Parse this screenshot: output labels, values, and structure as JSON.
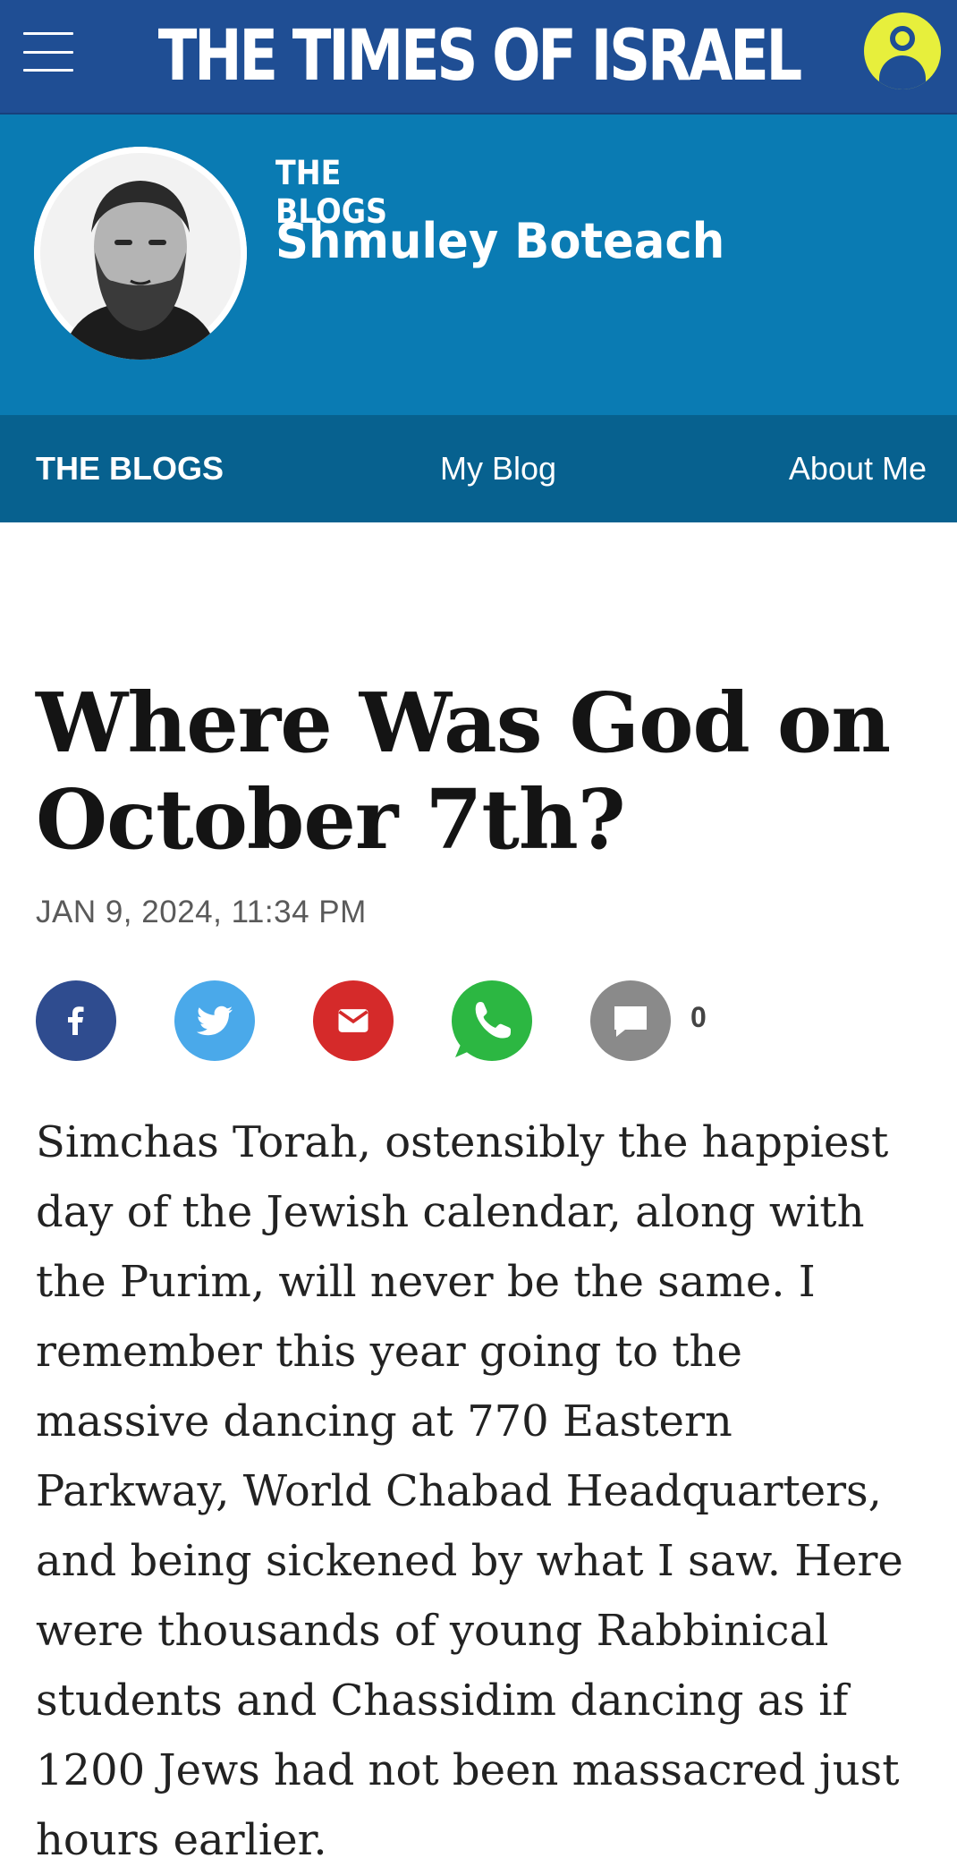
{
  "header": {
    "brand": "THE TIMES OF ISRAEL",
    "menu_icon": "hamburger-menu-icon",
    "user_icon": "user-account-icon",
    "colors": {
      "bar": "#1f4e94",
      "user_button": "#e7ef3c"
    }
  },
  "blog_header": {
    "kicker": "THE BLOGS",
    "author": "Shmuley Boteach",
    "avatar": "author-portrait",
    "colors": {
      "background": "#0a7bb3"
    }
  },
  "subnav": {
    "items": [
      "THE BLOGS",
      "My Blog",
      "About Me"
    ],
    "colors": {
      "background": "#07618f"
    }
  },
  "article": {
    "title": "Where Was God on October 7th?",
    "dateline": "JAN 9, 2024, 11:34 PM",
    "share": {
      "buttons": [
        {
          "name": "facebook",
          "icon": "facebook-icon",
          "color": "#2f4c8f"
        },
        {
          "name": "twitter",
          "icon": "twitter-bird-icon",
          "color": "#4aa9ea"
        },
        {
          "name": "email",
          "icon": "envelope-icon",
          "color": "#d52a2a"
        },
        {
          "name": "whatsapp",
          "icon": "whatsapp-icon",
          "color": "#2cb742"
        },
        {
          "name": "comments",
          "icon": "comment-bubble-icon",
          "color": "#8a8a8a"
        }
      ],
      "comment_count": "0"
    },
    "body": "Simchas Torah, ostensibly the happiest day of the Jewish calendar, along with the Purim, will never be the same. I remember this year going to the massive dancing at 770 Eastern Parkway, World Chabad Headquarters, and being sickened by what I saw. Here were thousands of young Rabbinical students and Chassidim dancing as if 1200 Jews had not been massacred just hours earlier."
  }
}
